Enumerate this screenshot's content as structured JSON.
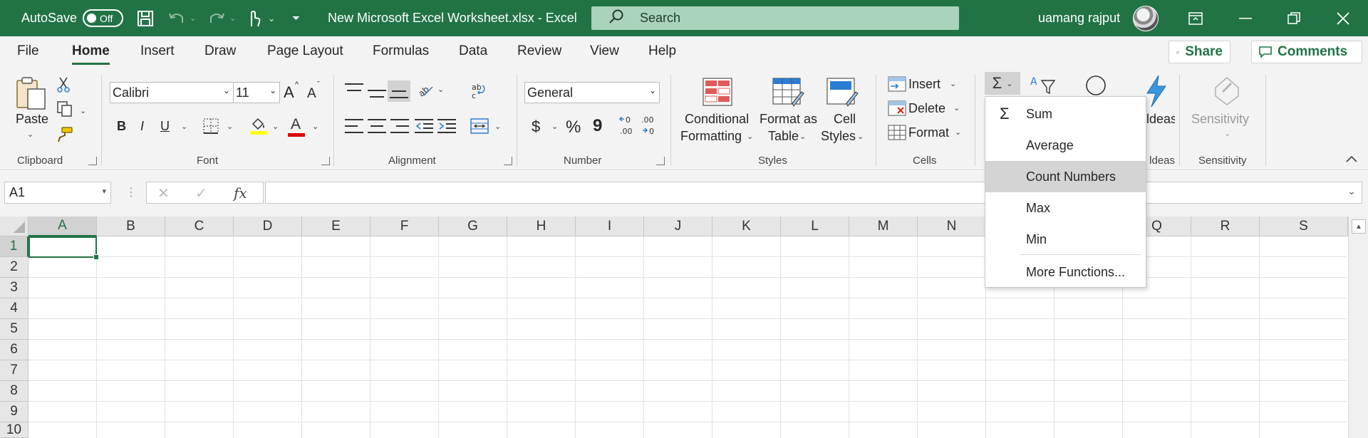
{
  "titlebar": {
    "autosave_label": "AutoSave",
    "autosave_state": "Off",
    "document_title": "New Microsoft Excel Worksheet.xlsx  -  Excel",
    "search_placeholder": "Search",
    "user_name": "uamang rajput",
    "background": "#217346"
  },
  "tabs": [
    "File",
    "Home",
    "Insert",
    "Draw",
    "Page Layout",
    "Formulas",
    "Data",
    "Review",
    "View",
    "Help"
  ],
  "active_tab": "Home",
  "tab_buttons": {
    "share": "Share",
    "comments": "Comments"
  },
  "ribbon": {
    "clipboard": {
      "label": "Clipboard",
      "paste": "Paste"
    },
    "font": {
      "label": "Font",
      "font_name": "Calibri",
      "font_size": "11",
      "bold": "B",
      "italic": "I",
      "underline": "U",
      "grow": "A",
      "shrink": "A",
      "font_color": "A"
    },
    "alignment": {
      "label": "Alignment"
    },
    "number": {
      "label": "Number",
      "format": "General",
      "currency": "$",
      "percent": "%",
      "comma": "9",
      "inc_decimal": "←0\n.00",
      "dec_decimal": ".00\n→0"
    },
    "styles": {
      "label": "Styles",
      "conditional_1": "Conditional",
      "conditional_2": "Formatting",
      "table_1": "Format as",
      "table_2": "Table",
      "cell_1": "Cell",
      "cell_2": "Styles"
    },
    "cells": {
      "label": "Cells",
      "insert": "Insert",
      "delete": "Delete",
      "format": "Format"
    },
    "ideas": {
      "label": "ldeas",
      "button": "ldeas"
    },
    "sensitivity": {
      "label": "Sensitivity",
      "button": "Sensitivity"
    }
  },
  "formula_bar": {
    "name_box": "A1",
    "cancel": "✕",
    "enter": "✓",
    "fx": "fx",
    "value": ""
  },
  "columns": [
    "A",
    "B",
    "C",
    "D",
    "E",
    "F",
    "G",
    "H",
    "I",
    "J",
    "K",
    "L",
    "M",
    "N",
    "",
    "",
    "Q",
    "R",
    "S"
  ],
  "rows": [
    "1",
    "2",
    "3",
    "4",
    "5",
    "6",
    "7",
    "8",
    "9",
    "10"
  ],
  "selected_cell": "A1",
  "autosum_menu": {
    "items": [
      {
        "label": "Sum",
        "icon": "sigma-icon"
      },
      {
        "label": "Average"
      },
      {
        "label": "Count Numbers",
        "highlighted": true
      },
      {
        "label": "Max"
      },
      {
        "label": "Min"
      },
      {
        "label": "More Functions..."
      }
    ]
  }
}
